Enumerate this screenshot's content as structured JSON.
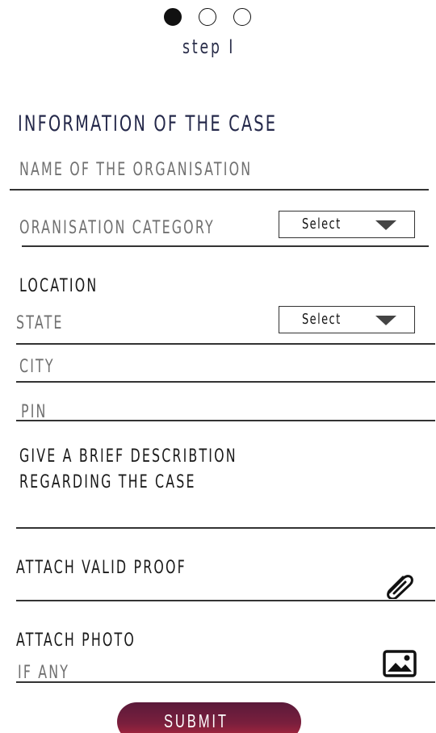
{
  "stepper": {
    "label": "step I",
    "steps_total": 3,
    "current_step": 1
  },
  "form": {
    "section_title": "INFORMATION OF THE CASE",
    "org_name_placeholder": "NAME OF THE ORGANISATION",
    "org_category_label": "ORANISATION CATEGORY",
    "org_category_select": "Select",
    "location_heading": "LOCATION",
    "state_label": "STATE",
    "state_select": "Select",
    "city_placeholder": "CITY",
    "pin_placeholder": "PIN",
    "description_line1": "GIVE A BRIEF DESCRIBTION",
    "description_line2": "REGARDING THE CASE",
    "proof_label": "ATTACH VALID PROOF",
    "proof_icon": "paperclip-icon",
    "photo_label": "ATTACH PHOTO",
    "photo_sublabel": "IF ANY",
    "photo_icon": "image-icon"
  },
  "actions": {
    "submit_label": "SUBMIT",
    "submit_color": "#7a1f3d"
  }
}
